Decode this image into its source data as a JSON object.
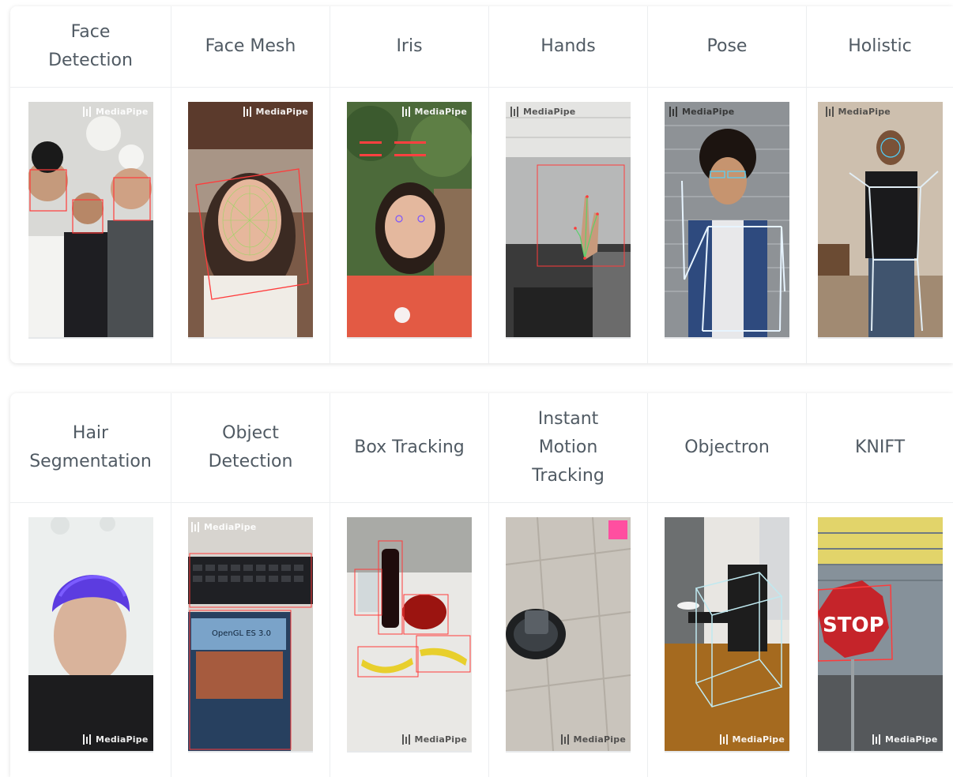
{
  "brand": "MediaPipe",
  "rows": [
    {
      "solutions": [
        {
          "id": "face-detection",
          "title_lines": [
            "Face",
            "Detection"
          ]
        },
        {
          "id": "face-mesh",
          "title_lines": [
            "Face Mesh"
          ]
        },
        {
          "id": "iris",
          "title_lines": [
            "Iris"
          ]
        },
        {
          "id": "hands",
          "title_lines": [
            "Hands"
          ]
        },
        {
          "id": "pose",
          "title_lines": [
            "Pose"
          ]
        },
        {
          "id": "holistic",
          "title_lines": [
            "Holistic"
          ]
        }
      ]
    },
    {
      "solutions": [
        {
          "id": "hair-segmentation",
          "title_lines": [
            "Hair",
            "Segmentation"
          ]
        },
        {
          "id": "object-detection",
          "title_lines": [
            "Object",
            "Detection"
          ]
        },
        {
          "id": "box-tracking",
          "title_lines": [
            "Box Tracking"
          ]
        },
        {
          "id": "instant-motion-tracking",
          "title_lines": [
            "Instant",
            "Motion",
            "Tracking"
          ]
        },
        {
          "id": "objectron",
          "title_lines": [
            "Objectron"
          ]
        },
        {
          "id": "knift",
          "title_lines": [
            "KNIFT"
          ]
        }
      ]
    }
  ],
  "stop_sign_text": "STOP",
  "book_text": "OpenGL ES 3.0"
}
